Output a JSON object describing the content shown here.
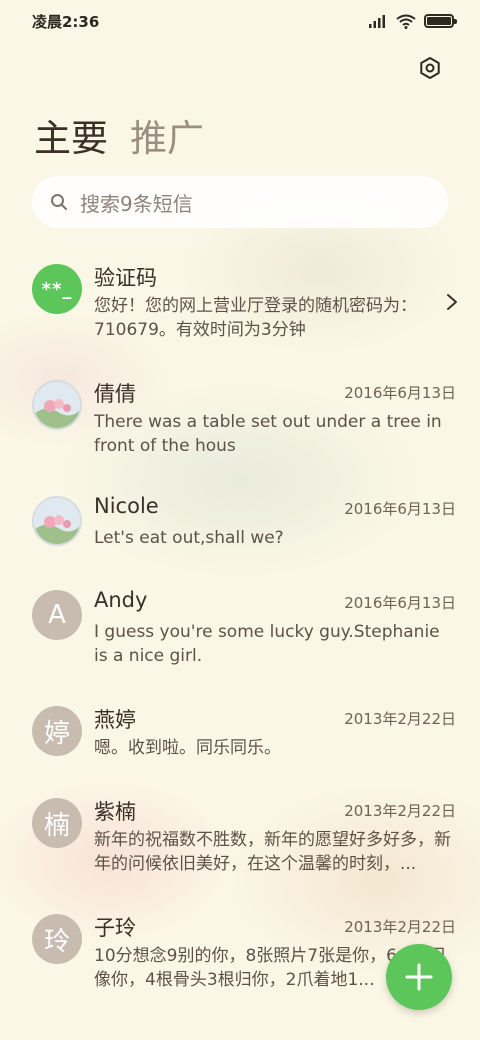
{
  "status": {
    "time": "凌晨2:36",
    "icons": [
      "signal-icon",
      "wifi-icon",
      "battery-icon"
    ]
  },
  "header": {
    "settings_icon": "gear-icon",
    "tabs": [
      {
        "label": "主要",
        "active": true
      },
      {
        "label": "推广",
        "active": false
      }
    ]
  },
  "search": {
    "placeholder": "搜索9条短信",
    "icon": "search-icon"
  },
  "conversations": [
    {
      "name": "验证码",
      "avatar_type": "code",
      "avatar_text": "**_",
      "date": "",
      "preview": "您好！您的网上营业厅登录的随机密码为：710679。有效时间为3分钟",
      "has_chevron": true
    },
    {
      "name": "倩倩",
      "avatar_type": "photo",
      "avatar_text": "",
      "date": "2016年6月13日",
      "preview": "There was a table set out under a tree in front of the hous"
    },
    {
      "name": "Nicole",
      "avatar_type": "photo",
      "avatar_text": "",
      "date": "2016年6月13日",
      "preview": "Let's eat out,shall we?"
    },
    {
      "name": "Andy",
      "avatar_type": "letter",
      "avatar_text": "A",
      "date": "2016年6月13日",
      "preview": "I guess you're some lucky guy.Stephanie is a nice girl."
    },
    {
      "name": "燕婷",
      "avatar_type": "letter",
      "avatar_text": "婷",
      "date": "2013年2月22日",
      "preview": "嗯。收到啦。同乐同乐。"
    },
    {
      "name": "紫楠",
      "avatar_type": "letter",
      "avatar_text": "楠",
      "date": "2013年2月22日",
      "preview": "新年的祝福数不胜数，新年的愿望好多好多，新年的问候依旧美好，在这个温馨的时刻，..."
    },
    {
      "name": "子玲",
      "avatar_type": "letter",
      "avatar_text": "玲",
      "date": "2013年2月22日",
      "preview": "10分想念9别的你，8张照片7张是你，6... 5只像你，4根骨头3根归你，2爪着地1..."
    }
  ],
  "fab": {
    "icon": "plus-icon"
  },
  "colors": {
    "accent": "#5cc65a",
    "background": "#fbf7e6",
    "avatar_letter_bg": "#c8bcb0"
  }
}
